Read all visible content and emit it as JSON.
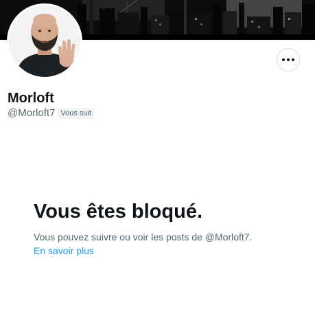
{
  "profile": {
    "display_name": "Morloft",
    "handle": "@Morloft7",
    "follows_you_badge": "Vous suit",
    "more_button_icon": "more-horizontal-icon"
  },
  "blocked": {
    "title": "Vous êtes bloqué.",
    "text": "Vous pouvez suivre ou voir les posts de @Morloft7.",
    "learn_more": "En savoir plus"
  },
  "colors": {
    "text_primary": "#0f1419",
    "text_secondary": "#536471",
    "link": "#1d9bf0",
    "badge_bg": "#eff3f4",
    "border": "#cfd9de"
  }
}
